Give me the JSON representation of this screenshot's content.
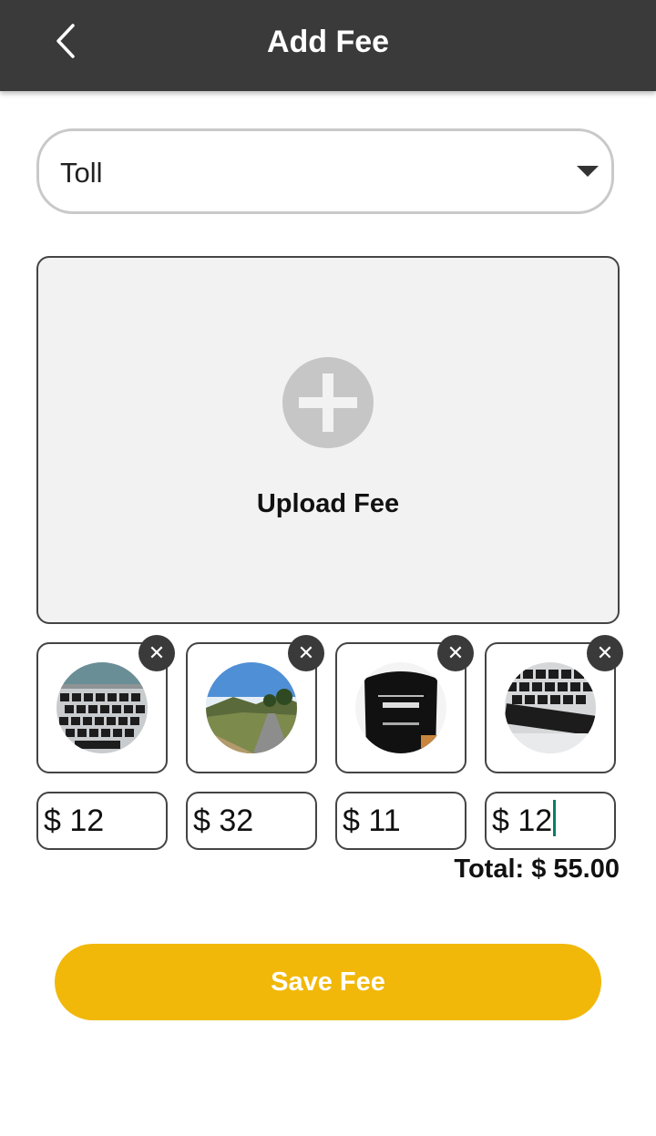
{
  "header": {
    "title": "Add Fee",
    "back_icon": "chevron-left-icon"
  },
  "fee_type": {
    "selected": "Toll",
    "dropdown_icon": "caret-down-icon"
  },
  "upload": {
    "label": "Upload Fee",
    "icon": "plus-circle-icon"
  },
  "receipts": [
    {
      "image": "laptop keyboard photo",
      "amount": "$ 12",
      "remove_icon": "close-icon"
    },
    {
      "image": "mountain road photo",
      "amount": "$ 32",
      "remove_icon": "close-icon"
    },
    {
      "image": "coffee package photo",
      "amount": "$ 11",
      "remove_icon": "close-icon"
    },
    {
      "image": "laptop keyboard photo",
      "amount": "$ 12",
      "remove_icon": "close-icon"
    }
  ],
  "total": "Total: $ 55.00",
  "save_button": "Save Fee",
  "colors": {
    "header_bg": "#3a3a3a",
    "accent": "#f1b80a",
    "caret": "#0a7d6b"
  }
}
